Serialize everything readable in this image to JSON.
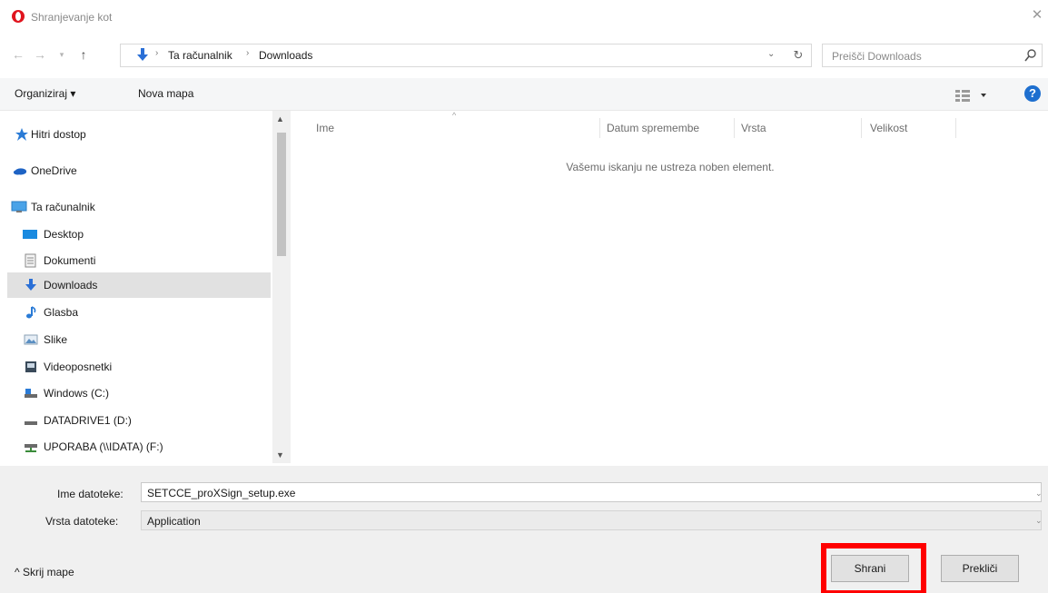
{
  "window": {
    "title": "Shranjevanje kot",
    "close_glyph": "✕"
  },
  "nav": {
    "back_glyph": "←",
    "forward_glyph": "→",
    "recent_glyph": "▾",
    "up_glyph": "↑",
    "breadcrumb_sep": "›",
    "breadcrumb": [
      "Ta računalnik",
      "Downloads"
    ],
    "dropdown_glyph": "⌄",
    "refresh_glyph": "↻",
    "search_placeholder": "Preišči Downloads"
  },
  "toolbar": {
    "organize_label": "Organiziraj ▾",
    "new_folder_label": "Nova mapa",
    "help_glyph": "?"
  },
  "sidebar": {
    "items": [
      {
        "label": "Hitri dostop",
        "icon": "star-icon"
      },
      {
        "label": "OneDrive",
        "icon": "cloud-icon"
      },
      {
        "label": "Ta računalnik",
        "icon": "computer-icon"
      },
      {
        "label": "Desktop",
        "icon": "desktop-icon"
      },
      {
        "label": "Dokumenti",
        "icon": "document-icon"
      },
      {
        "label": "Downloads",
        "icon": "download-icon",
        "selected": true
      },
      {
        "label": "Glasba",
        "icon": "music-icon"
      },
      {
        "label": "Slike",
        "icon": "picture-icon"
      },
      {
        "label": "Videoposnetki",
        "icon": "video-icon"
      },
      {
        "label": "Windows  (C:)",
        "icon": "drive-icon"
      },
      {
        "label": "DATADRIVE1 (D:)",
        "icon": "drive-icon"
      },
      {
        "label": "UPORABA (\\\\IDATA) (F:)",
        "icon": "network-drive-icon"
      }
    ]
  },
  "filelist": {
    "columns": [
      "Ime",
      "Datum spremembe",
      "Vrsta",
      "Velikost"
    ],
    "empty_message": "Vašemu iskanju ne ustreza noben element."
  },
  "form": {
    "filename_label": "Ime datoteke:",
    "filename_value": "SETCCE_proXSign_setup.exe",
    "filetype_label": "Vrsta datoteke:",
    "filetype_value": "Application"
  },
  "footer": {
    "hide_folders_label": "^  Skrij mape",
    "save_label": "Shrani",
    "cancel_label": "Prekliči"
  },
  "colors": {
    "highlight": "#ff0000",
    "accent": "#1e6fcf"
  }
}
